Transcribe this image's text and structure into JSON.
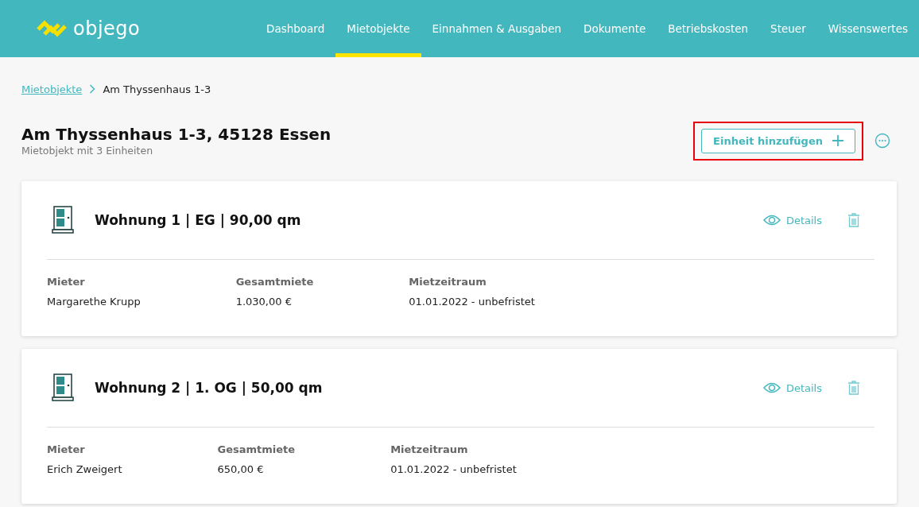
{
  "brand": {
    "name": "objego"
  },
  "nav": [
    {
      "label": "Dashboard",
      "selected": false
    },
    {
      "label": "Mietobjekte",
      "selected": true
    },
    {
      "label": "Einnahmen & Ausgaben",
      "selected": false
    },
    {
      "label": "Dokumente",
      "selected": false
    },
    {
      "label": "Betriebskosten",
      "selected": false
    },
    {
      "label": "Steuer",
      "selected": false
    },
    {
      "label": "Wissenswertes",
      "selected": false
    }
  ],
  "breadcrumb": {
    "link": "Mietobjekte",
    "current": "Am Thyssenhaus 1-3"
  },
  "page": {
    "title": "Am Thyssenhaus 1-3, 45128 Essen",
    "subtitle": "Mietobjekt mit 3 Einheiten",
    "add_button": "Einheit hinzufügen",
    "add_button_highlighted": true
  },
  "units": [
    {
      "title": "Wohnung 1 | EG | 90,00 qm",
      "details": "Details",
      "fields": [
        {
          "label": "Mieter",
          "value": "Margarethe Krupp"
        },
        {
          "label": "Gesamtmiete",
          "value": "1.030,00 €"
        },
        {
          "label": "Mietzeitraum",
          "value": "01.01.2022 - unbefristet"
        }
      ]
    },
    {
      "title": "Wohnung 2 | 1. OG | 50,00 qm",
      "details": "Details",
      "fields": [
        {
          "label": "Mieter",
          "value": "Erich Zweigert"
        },
        {
          "label": "Gesamtmiete",
          "value": "650,00 €"
        },
        {
          "label": "Mietzeitraum",
          "value": "01.01.2022 - unbefristet"
        }
      ]
    }
  ]
}
